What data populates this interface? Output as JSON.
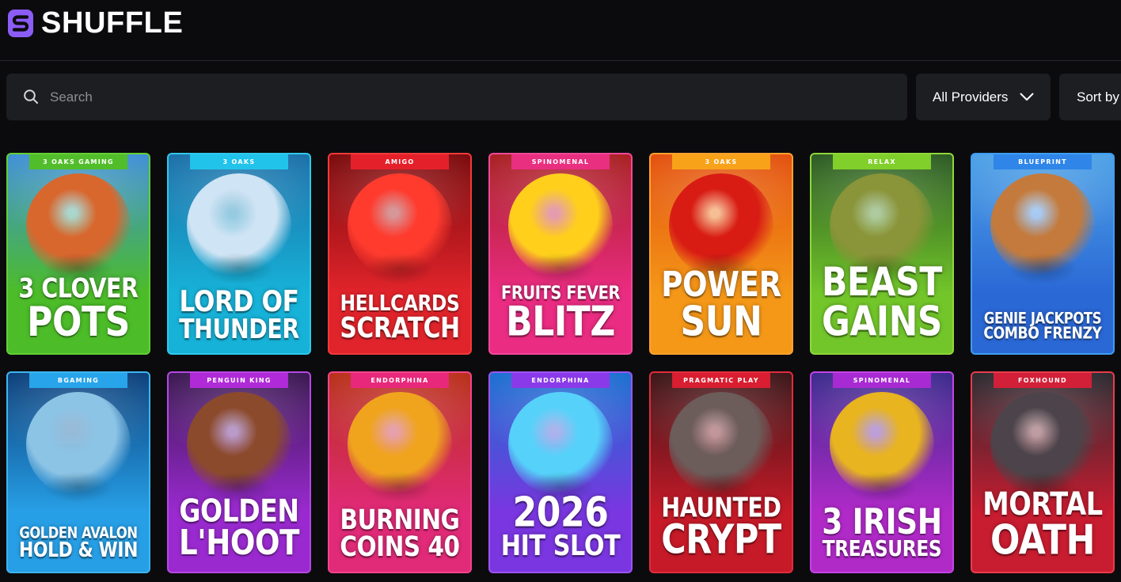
{
  "theme": {
    "background": "#0b0b0d",
    "panel": "#1d1e22",
    "divider": "#26262b"
  },
  "brand": {
    "name": "SHUFFLE",
    "logo_icon": "shuffle-logo-icon",
    "color": "#8b5cf6"
  },
  "search": {
    "icon": "search-icon",
    "placeholder": "Search",
    "value": ""
  },
  "filters": {
    "providers": {
      "label": "All Providers",
      "icon": "chevron-down-icon"
    },
    "sort": {
      "label": "Sort by"
    }
  },
  "games": [
    {
      "provider": "3 OAKS GAMING",
      "title_lines": [
        "3 CLOVER",
        "POTS"
      ],
      "colors": {
        "accent": "#63cf35",
        "tab": "#52bd2a",
        "art_top": "#3f8fd8",
        "art_bottom": "#4cbd28",
        "figure": "#d8672e"
      }
    },
    {
      "provider": "3 OAKS",
      "title_lines": [
        "LORD OF",
        "THUNDER"
      ],
      "colors": {
        "accent": "#2fc9ec",
        "tab": "#22c3ea",
        "art_top": "#1b6fa8",
        "art_bottom": "#17b2d8",
        "figure": "#cfe4f4"
      }
    },
    {
      "provider": "AMIGO",
      "title_lines": [
        "HELLCARDS",
        "SCRATCH"
      ],
      "colors": {
        "accent": "#f23a3a",
        "tab": "#e4212a",
        "art_top": "#7a0a0c",
        "art_bottom": "#e1242b",
        "figure": "#ff3b2e"
      }
    },
    {
      "provider": "SPINOMENAL",
      "title_lines": [
        "FRUITS FEVER",
        "BLITZ"
      ],
      "colors": {
        "accent": "#f0489a",
        "tab": "#e92f80",
        "art_top": "#a82022",
        "art_bottom": "#ea2c82",
        "figure": "#ffcf1c"
      }
    },
    {
      "provider": "3 OAKS",
      "title_lines": [
        "POWER",
        "SUN"
      ],
      "colors": {
        "accent": "#ffa12e",
        "tab": "#f8a21a",
        "art_top": "#e3500e",
        "art_bottom": "#f59818",
        "figure": "#d81c14"
      }
    },
    {
      "provider": "RELAX",
      "title_lines": [
        "BEAST",
        "GAINS"
      ],
      "colors": {
        "accent": "#8fd83a",
        "tab": "#80cf2a",
        "art_top": "#2c5a24",
        "art_bottom": "#72c62a",
        "figure": "#8a9438"
      }
    },
    {
      "provider": "BLUEPRINT",
      "title_lines": [
        "GENIE JACKPOTS",
        "COMBO FRENZY"
      ],
      "colors": {
        "accent": "#3f9df2",
        "tab": "#2f86e8",
        "art_top": "#4ea2e6",
        "art_bottom": "#2a68d6",
        "figure": "#c47a3c"
      }
    },
    {
      "provider": "BGAMING",
      "title_lines": [
        "GOLDEN AVALON",
        "HOLD & WIN"
      ],
      "colors": {
        "accent": "#3cb6f2",
        "tab": "#28a4ea",
        "art_top": "#0c3f7a",
        "art_bottom": "#279fe6",
        "figure": "#8cc4e6"
      }
    },
    {
      "provider": "PENGUIN KING",
      "title_lines": [
        "GOLDEN",
        "L'HOOT"
      ],
      "colors": {
        "accent": "#b548e4",
        "tab": "#b02ad8",
        "art_top": "#3a1850",
        "art_bottom": "#9a2ad0",
        "figure": "#8c4a2c"
      }
    },
    {
      "provider": "ENDORPHINA",
      "title_lines": [
        "BURNING",
        "COINS 40"
      ],
      "colors": {
        "accent": "#f2448c",
        "tab": "#e8287a",
        "art_top": "#b83018",
        "art_bottom": "#e12a78",
        "figure": "#f0a41e"
      }
    },
    {
      "provider": "ENDORPHINA",
      "title_lines": [
        "2026",
        "HIT SLOT"
      ],
      "colors": {
        "accent": "#9c54f2",
        "tab": "#8a3ae8",
        "art_top": "#1a70d0",
        "art_bottom": "#7a36e0",
        "figure": "#56d2fa"
      }
    },
    {
      "provider": "PRAGMATIC PLAY",
      "title_lines": [
        "HAUNTED",
        "CRYPT"
      ],
      "colors": {
        "accent": "#e22c3c",
        "tab": "#d81e30",
        "art_top": "#3a1618",
        "art_bottom": "#c61a28",
        "figure": "#6c5c5a"
      }
    },
    {
      "provider": "SPINOMENAL",
      "title_lines": [
        "3 IRISH",
        "TREASURES"
      ],
      "colors": {
        "accent": "#c444e4",
        "tab": "#a82ad2",
        "art_top": "#3a2a8c",
        "art_bottom": "#b02ac8",
        "figure": "#e8b420"
      }
    },
    {
      "provider": "FOXHOUND",
      "title_lines": [
        "MORTAL",
        "OATH"
      ],
      "colors": {
        "accent": "#ea3c4c",
        "tab": "#d22038",
        "art_top": "#2a2a30",
        "art_bottom": "#c81c30",
        "figure": "#4c444a"
      }
    }
  ]
}
